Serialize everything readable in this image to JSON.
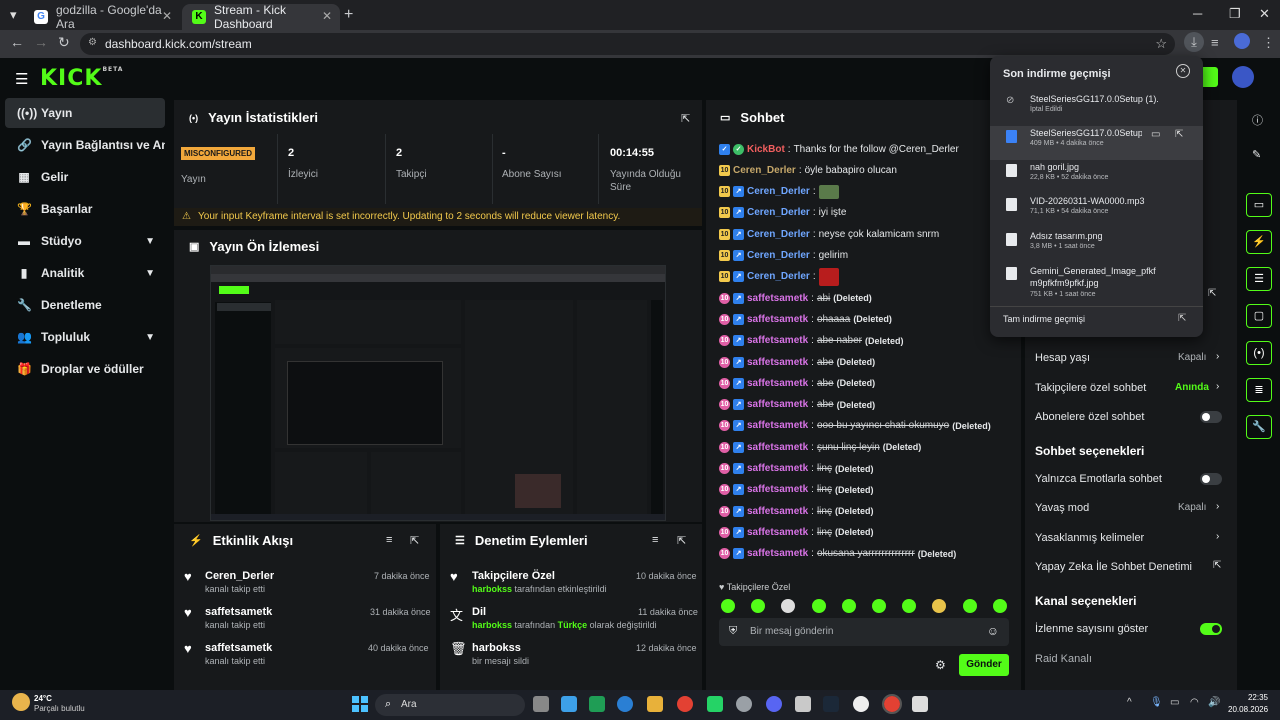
{
  "browser": {
    "tabs": [
      {
        "label": "godzilla - Google'da Ara"
      },
      {
        "label": "Stream - Kick Dashboard"
      }
    ],
    "url": "dashboard.kick.com/stream"
  },
  "logo": {
    "text": "KICK",
    "beta": "BETA"
  },
  "sidebar": {
    "items": [
      {
        "label": "Yayın",
        "icon": "broadcast-icon"
      },
      {
        "label": "Yayın Bağlantısı ve Anahtar",
        "icon": "link-icon"
      },
      {
        "label": "Gelir",
        "icon": "revenue-icon"
      },
      {
        "label": "Başarılar",
        "icon": "trophy-icon"
      },
      {
        "label": "Stüdyo",
        "icon": "studio-icon"
      },
      {
        "label": "Analitik",
        "icon": "analytics-icon"
      },
      {
        "label": "Denetleme",
        "icon": "moderation-icon"
      },
      {
        "label": "Topluluk",
        "icon": "community-icon"
      },
      {
        "label": "Droplar ve ödüller",
        "icon": "drops-icon"
      }
    ]
  },
  "stats": {
    "title": "Yayın İstatistikleri",
    "badge": "MISCONFIGURED",
    "status_label": "Yayın",
    "items": [
      {
        "value": "2",
        "label": "İzleyici"
      },
      {
        "value": "2",
        "label": "Takipçi"
      },
      {
        "value": "-",
        "label": "Abone Sayısı"
      },
      {
        "value": "00:14:55",
        "label": "Yayında Olduğu Süre"
      }
    ],
    "warning": "Your input Keyframe interval is set incorrectly. Updating to 2 seconds will reduce viewer latency."
  },
  "preview": {
    "title": "Yayın Ön İzlemesi"
  },
  "activity": {
    "title": "Etkinlik Akışı",
    "items": [
      {
        "user": "Ceren_Derler",
        "sub": "kanalı takip etti",
        "time": "7 dakika önce"
      },
      {
        "user": "saffetsametk",
        "sub": "kanalı takip etti",
        "time": "31 dakika önce"
      },
      {
        "user": "saffetsametk",
        "sub": "kanalı takip etti",
        "time": "40 dakika önce"
      }
    ]
  },
  "moderation": {
    "title": "Denetim Eylemleri",
    "items": [
      {
        "title": "Takipçilere Özel",
        "actor": "harbokss",
        "middle": "tarafından etkinleştirildi",
        "highlight": "",
        "tail": "",
        "time": "10 dakika önce"
      },
      {
        "title": "Dil",
        "actor": "harbokss",
        "middle": "tarafından",
        "highlight": "Türkçe",
        "tail": "olarak değiştirildi",
        "time": "11 dakika önce"
      },
      {
        "title": "harbokss",
        "actor": "",
        "middle": "bir mesajı sildi",
        "highlight": "",
        "tail": "",
        "time": "12 dakika önce"
      }
    ]
  },
  "chat": {
    "title": "Sohbet",
    "messages": [
      {
        "user": "KickBot",
        "text": "Thanks for the follow @Ceren_Derler",
        "deleted": false
      },
      {
        "user": "Ceren_Derler",
        "text": "öyle babapiro olucan",
        "deleted": false
      },
      {
        "user": "Ceren_Derler",
        "text": "",
        "deleted": false
      },
      {
        "user": "Ceren_Derler",
        "text": "iyi işte",
        "deleted": false
      },
      {
        "user": "Ceren_Derler",
        "text": "neyse çok kalamicam snrm",
        "deleted": false
      },
      {
        "user": "Ceren_Derler",
        "text": "gelirim",
        "deleted": false
      },
      {
        "user": "Ceren_Derler",
        "text": "",
        "deleted": false
      },
      {
        "user": "saffetsametk",
        "text": "abi",
        "deleted": true
      },
      {
        "user": "saffetsametk",
        "text": "ohaaaa",
        "deleted": true
      },
      {
        "user": "saffetsametk",
        "text": "abe naber",
        "deleted": true
      },
      {
        "user": "saffetsametk",
        "text": "abe",
        "deleted": true
      },
      {
        "user": "saffetsametk",
        "text": "abe",
        "deleted": true
      },
      {
        "user": "saffetsametk",
        "text": "abe",
        "deleted": true
      },
      {
        "user": "saffetsametk",
        "text": "ooo bu yayıncı chati okumuyo",
        "deleted": true
      },
      {
        "user": "saffetsametk",
        "text": "şunu linç leyin",
        "deleted": true
      },
      {
        "user": "saffetsametk",
        "text": "linç",
        "deleted": true
      },
      {
        "user": "saffetsametk",
        "text": "linç",
        "deleted": true
      },
      {
        "user": "saffetsametk",
        "text": "linç",
        "deleted": true
      },
      {
        "user": "saffetsametk",
        "text": "linç",
        "deleted": true
      },
      {
        "user": "saffetsametk",
        "text": "okusana yarrrrrrrrrrrrrr",
        "deleted": true
      }
    ],
    "deleted_label": "(Deleted)",
    "mode_label": "Takipçilere Özel",
    "input_placeholder": "Bir mesaj gönderin",
    "send_label": "Gönder"
  },
  "settings": {
    "account_age": {
      "label": "Hesap yaşı",
      "value": "Kapalı"
    },
    "followers_only": {
      "label": "Takipçilere özel sohbet",
      "value": "Anında"
    },
    "subs_only": {
      "label": "Abonelere özel sohbet"
    },
    "chat_options_title": "Sohbet seçenekleri",
    "emote_only": {
      "label": "Yalnızca Emotlarla sohbet"
    },
    "slow_mode": {
      "label": "Yavaş mod",
      "value": "Kapalı"
    },
    "banned_words": {
      "label": "Yasaklanmış kelimeler"
    },
    "ai_mod": {
      "label": "Yapay Zeka İle Sohbet Denetimi"
    },
    "channel_options_title": "Kanal seçenekleri",
    "show_viewers": {
      "label": "İzlenme sayısını göster"
    },
    "raid": {
      "label": "Raid Kanalı"
    }
  },
  "downloads": {
    "title": "Son indirme geçmişi",
    "items": [
      {
        "name": "SteelSeriesGG117.0.0Setup (1).exe",
        "meta": "İptal Edildi",
        "icon": "cancelled-icon"
      },
      {
        "name": "SteelSeriesGG117.0.0Setup.exe",
        "meta": "409 MB • 4 dakika önce",
        "icon": "exe-icon"
      },
      {
        "name": "nah goril.jpg",
        "meta": "22,8 KB • 52 dakika önce",
        "icon": "file-icon"
      },
      {
        "name": "VID-20260311-WA0000.mp3",
        "meta": "71,1 KB • 54 dakika önce",
        "icon": "file-icon"
      },
      {
        "name": "Adsız tasarım.png",
        "meta": "3,8 MB • 1 saat önce",
        "icon": "file-icon"
      },
      {
        "name": "Gemini_Generated_Image_pfkfm9pfkfm9pfkf.jpg",
        "meta": "751 KB • 1 saat önce",
        "icon": "file-icon"
      }
    ],
    "full_history": "Tam indirme geçmişi"
  },
  "taskbar": {
    "weather_temp": "24°C",
    "weather_desc": "Parçalı bulutlu",
    "search": "Ara",
    "time": "22:35",
    "date": "20.08.2026"
  },
  "colors": {
    "accent": "#53fc18",
    "panel": "#17191b",
    "bg": "#0b0e0f"
  }
}
